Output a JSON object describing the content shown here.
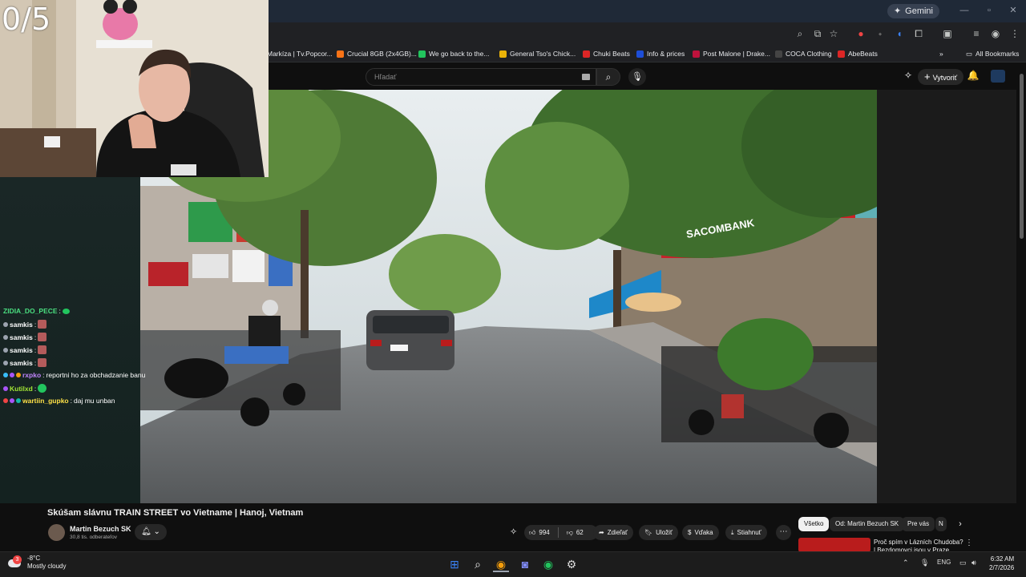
{
  "overlay": {
    "counter": "0/5"
  },
  "browser": {
    "gemini_label": "Gemini",
    "bookmarks": [
      {
        "label": "Markíza | Tv.Popcor...",
        "color": "#1f2937"
      },
      {
        "label": "Crucial 8GB (2x4GB)...",
        "color": "#f97316"
      },
      {
        "label": "We go back to the...",
        "color": "#22c55e"
      },
      {
        "label": "General Tso's Chick...",
        "color": "#eab308"
      },
      {
        "label": "Chuki Beats",
        "color": "#dc2626"
      },
      {
        "label": "Info & prices",
        "color": "#1d4ed8"
      },
      {
        "label": "Post Malone | Drake...",
        "color": "#be123c"
      },
      {
        "label": "COCA Clothing",
        "color": "#111111"
      },
      {
        "label": "AbeBeats",
        "color": "#dc2626"
      }
    ],
    "all_bookmarks": "All Bookmarks"
  },
  "youtube": {
    "search_placeholder": "Hľadať",
    "create_label": "Vytvoriť",
    "video_title": "Skúšam slávnu TRAIN STREET vo Vietname | Hanoj, Vietnam",
    "channel_name": "Martin Bezuch SK",
    "subscribers": "30,8 tis. odberateľov",
    "likes": "994",
    "dislikes": "62",
    "share": "Zdieľať",
    "save": "Uložiť",
    "thanks": "Vďaka",
    "download": "Stiahnuť",
    "chips": [
      "Všetko",
      "Od: Martin Bezuch SK",
      "Pre vás",
      "N"
    ],
    "rec_title": "Proč spím v Lázních Chudoba? | Bezdomovci jsou v Praze..."
  },
  "chat": [
    {
      "user": "ZIDIA_DO_PECE",
      "msg": "",
      "color": "#4ade80",
      "emote": "#22c55e"
    },
    {
      "user": "samkis",
      "msg": "",
      "color": "#e5e7eb",
      "emote": "#b45b5b"
    },
    {
      "user": "samkis",
      "msg": "",
      "color": "#e5e7eb",
      "emote": "#b45b5b"
    },
    {
      "user": "samkis",
      "msg": "",
      "color": "#e5e7eb",
      "emote": "#b45b5b"
    },
    {
      "user": "samkis",
      "msg": "",
      "color": "#e5e7eb",
      "emote": "#b45b5b"
    },
    {
      "user": "rxpko",
      "msg": "reportni ho za obchadzanie banu",
      "color": "#c084fc",
      "emote": ""
    },
    {
      "user": "Kutilxd",
      "msg": "",
      "color": "#a3e635",
      "emote": "#22c55e"
    },
    {
      "user": "wartiin_gupko",
      "msg": "daj mu unban",
      "color": "#fde047",
      "emote": ""
    }
  ],
  "taskbar": {
    "temperature": "-8°C",
    "weather": "Mostly cloudy",
    "lang": "ENG",
    "time": "6:32 AM",
    "date": "2/7/2026",
    "weather_badge": "3"
  },
  "video_scene": {
    "bank_sign": "SACOMBANK"
  }
}
